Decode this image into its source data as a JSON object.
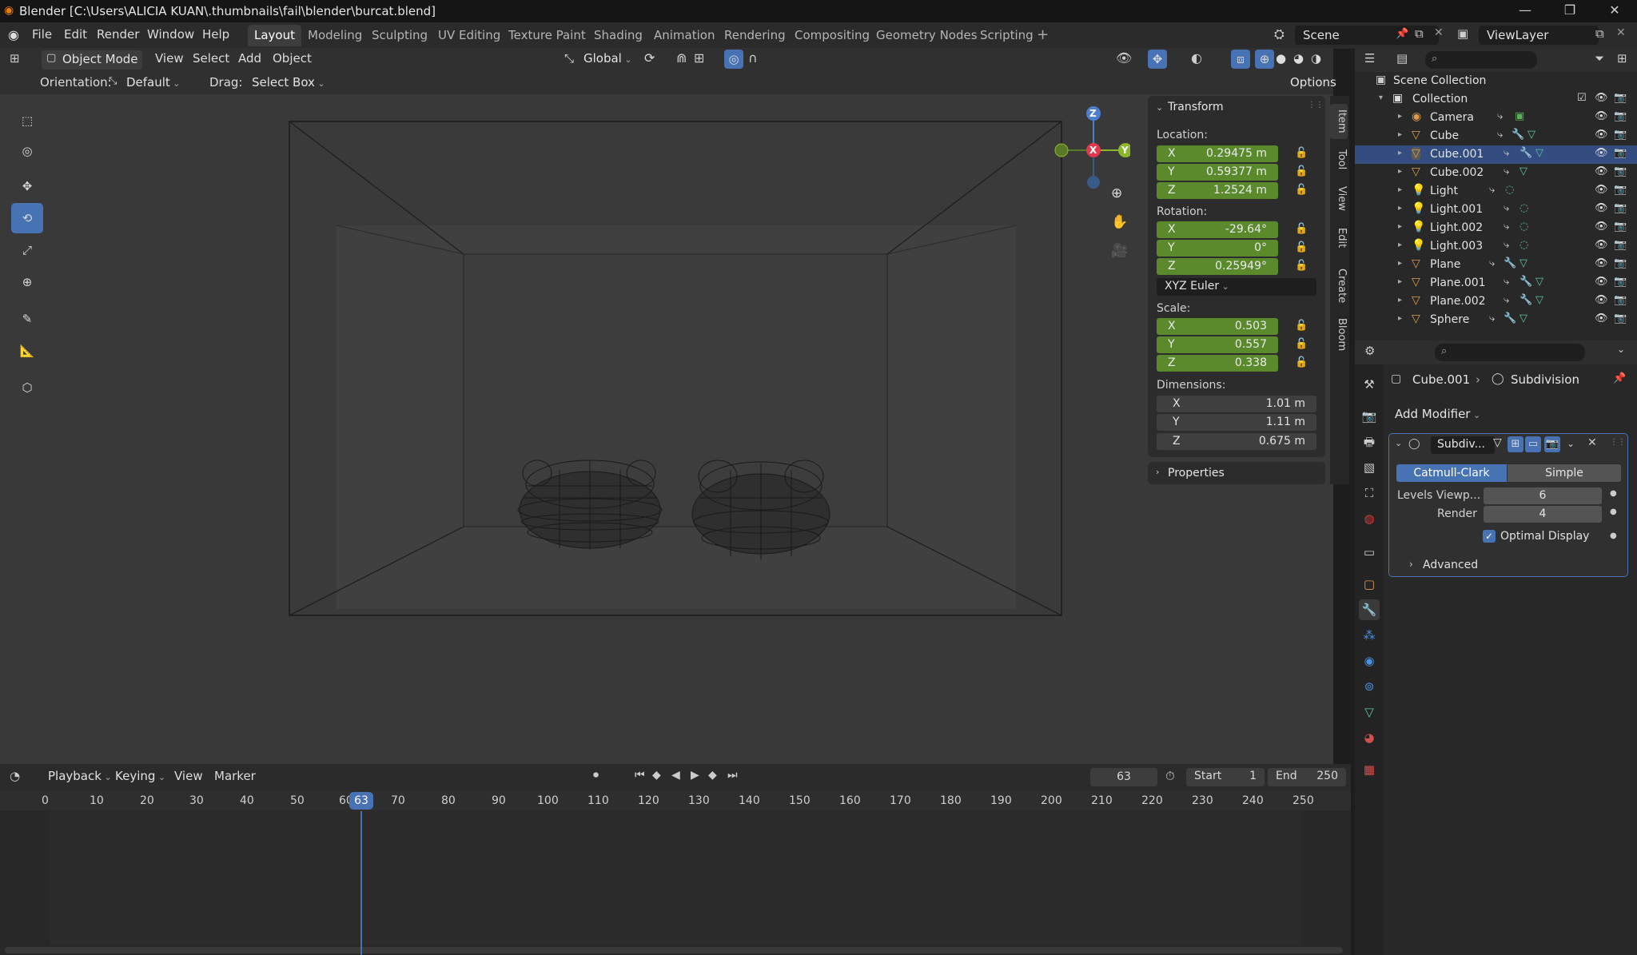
{
  "window": {
    "title": "Blender [C:\\Users\\ALICIA KUAN\\.thumbnails\\fail\\blender\\burcat.blend]"
  },
  "menus": [
    "File",
    "Edit",
    "Render",
    "Window",
    "Help"
  ],
  "workspaces": [
    "Layout",
    "Modeling",
    "Sculpting",
    "UV Editing",
    "Texture Paint",
    "Shading",
    "Animation",
    "Rendering",
    "Compositing",
    "Geometry Nodes",
    "Scripting"
  ],
  "active_workspace": "Layout",
  "scene": "Scene",
  "view_layer": "ViewLayer",
  "viewport_header": {
    "mode": "Object Mode",
    "menus": [
      "View",
      "Select",
      "Add",
      "Object"
    ],
    "transform_orientation": "Global",
    "orientation_label": "Orientation:",
    "orientation_value": "Default",
    "drag_label": "Drag:",
    "drag_value": "Select Box",
    "options": "Options"
  },
  "gizmo": {
    "z": "Z",
    "x": "X",
    "y": "Y"
  },
  "npanel": {
    "tabs": [
      "Item",
      "Tool",
      "View",
      "Edit",
      "Create",
      "Bloom"
    ],
    "transform_title": "Transform",
    "location_label": "Location:",
    "location": [
      {
        "axis": "X",
        "value": "0.29475 m"
      },
      {
        "axis": "Y",
        "value": "0.59377 m"
      },
      {
        "axis": "Z",
        "value": "1.2524 m"
      }
    ],
    "rotation_label": "Rotation:",
    "rotation": [
      {
        "axis": "X",
        "value": "-29.64°"
      },
      {
        "axis": "Y",
        "value": "0°"
      },
      {
        "axis": "Z",
        "value": "0.25949°"
      }
    ],
    "rotation_mode": "XYZ Euler",
    "scale_label": "Scale:",
    "scale": [
      {
        "axis": "X",
        "value": "0.503"
      },
      {
        "axis": "Y",
        "value": "0.557"
      },
      {
        "axis": "Z",
        "value": "0.338"
      }
    ],
    "dimensions_label": "Dimensions:",
    "dimensions": [
      {
        "axis": "X",
        "value": "1.01 m"
      },
      {
        "axis": "Y",
        "value": "1.11 m"
      },
      {
        "axis": "Z",
        "value": "0.675 m"
      }
    ],
    "properties_title": "Properties"
  },
  "outliner": {
    "scene_collection": "Scene Collection",
    "collection": "Collection",
    "items": [
      {
        "name": "Camera",
        "icon": "camera-icon"
      },
      {
        "name": "Cube",
        "icon": "mesh-icon"
      },
      {
        "name": "Cube.001",
        "icon": "mesh-icon",
        "selected": true
      },
      {
        "name": "Cube.002",
        "icon": "mesh-icon"
      },
      {
        "name": "Light",
        "icon": "light-icon"
      },
      {
        "name": "Light.001",
        "icon": "light-icon"
      },
      {
        "name": "Light.002",
        "icon": "light-icon"
      },
      {
        "name": "Light.003",
        "icon": "light-icon"
      },
      {
        "name": "Plane",
        "icon": "mesh-icon"
      },
      {
        "name": "Plane.001",
        "icon": "mesh-icon"
      },
      {
        "name": "Plane.002",
        "icon": "mesh-icon"
      },
      {
        "name": "Sphere",
        "icon": "mesh-icon"
      }
    ]
  },
  "properties": {
    "breadcrumb_object": "Cube.001",
    "breadcrumb_modifier": "Subdivision",
    "add_modifier": "Add Modifier",
    "modifier_name": "Subdiv...",
    "catmull_clark": "Catmull-Clark",
    "simple": "Simple",
    "levels_viewport_label": "Levels Viewp...",
    "levels_viewport": "6",
    "render_label": "Render",
    "render": "4",
    "optimal_display": "Optimal Display",
    "advanced": "Advanced"
  },
  "timeline": {
    "menus": [
      "Playback",
      "Keying",
      "View",
      "Marker"
    ],
    "current_frame": "63",
    "start_label": "Start",
    "start": "1",
    "end_label": "End",
    "end": "250",
    "ticks": [
      "0",
      "10",
      "20",
      "30",
      "40",
      "50",
      "60",
      "70",
      "80",
      "90",
      "100",
      "110",
      "120",
      "130",
      "140",
      "150",
      "160",
      "170",
      "180",
      "190",
      "200",
      "210",
      "220",
      "230",
      "240",
      "250"
    ]
  }
}
